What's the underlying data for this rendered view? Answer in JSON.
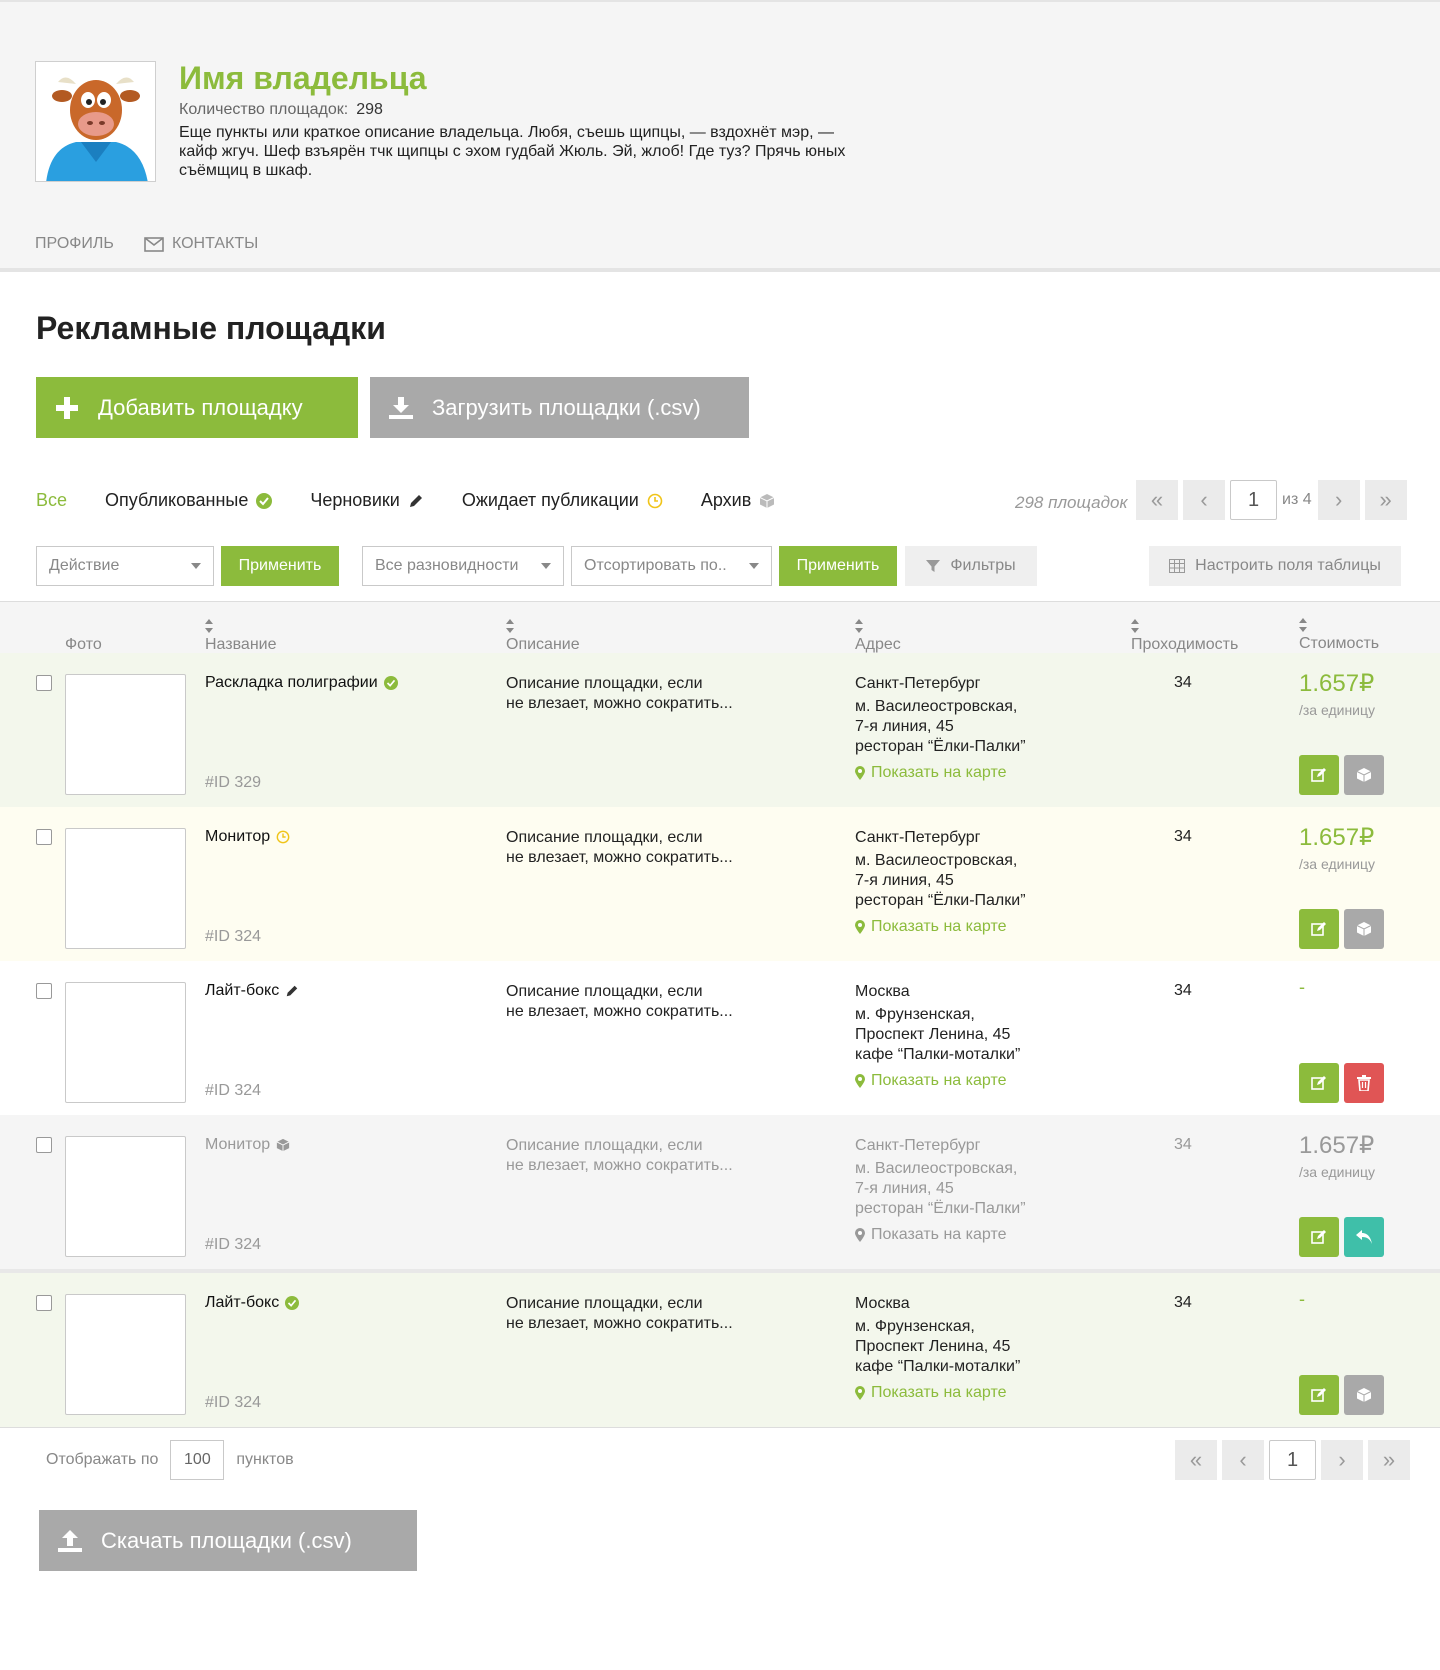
{
  "owner": {
    "name": "Имя владельца",
    "count_label": "Количество площадок:",
    "count_value": "298",
    "description": "Еще пункты или краткое описание владельца. Любя, съешь щипцы, — вздохнёт мэр, — кайф жгуч. Шеф взъярён тчк щипцы с эхом гудбай Жюль. Эй, жлоб! Где туз? Прячь юных съёмщиц в шкаф."
  },
  "tabs": {
    "profile": "ПРОФИЛЬ",
    "contacts": "КОНТАКТЫ"
  },
  "page_title": "Рекламные площадки",
  "buttons": {
    "add": "Добавить площадку",
    "upload": "Загрузить площадки (.csv)",
    "download": "Скачать площадки (.csv)"
  },
  "filters": {
    "all": "Все",
    "published": "Опубликованные",
    "drafts": "Черновики",
    "pending": "Ожидает публикации",
    "archive": "Архив"
  },
  "total": "298 площадок",
  "pager_top": {
    "page": "1",
    "of": "из 4"
  },
  "pager_bottom": {
    "page": "1"
  },
  "controls": {
    "action": "Действие",
    "apply": "Применить",
    "types": "Все разновидности",
    "sort": "Отсортировать по..",
    "filters": "Фильтры",
    "columns": "Настроить поля таблицы"
  },
  "columns": {
    "photo": "Фото",
    "name": "Название",
    "description": "Описание",
    "address": "Адрес",
    "traffic": "Проходимость",
    "cost": "Стоимость"
  },
  "rows": [
    {
      "name": "Раскладка полиграфии",
      "id": "#ID 329",
      "desc1": "Описание площадки, если",
      "desc2": "не влезает, можно сократить...",
      "city": "Санкт-Петербург",
      "a1": "м. Василеостровская,",
      "a2": "7-я линия, 45",
      "a3": "ресторан “Ёлки-Палки”",
      "map": "Показать на карте",
      "traffic": "34",
      "price": "1.657₽",
      "unit": "/за единицу"
    },
    {
      "name": "Монитор",
      "id": "#ID 324",
      "desc1": "Описание площадки, если",
      "desc2": "не влезает, можно сократить...",
      "city": "Санкт-Петербург",
      "a1": "м. Василеостровская,",
      "a2": "7-я линия, 45",
      "a3": "ресторан “Ёлки-Палки”",
      "map": "Показать на карте",
      "traffic": "34",
      "price": "1.657₽",
      "unit": "/за единицу"
    },
    {
      "name": "Лайт-бокс",
      "id": "#ID 324",
      "desc1": "Описание площадки, если",
      "desc2": "не влезает, можно сократить...",
      "city": "Москва",
      "a1": "м. Фрунзенская,",
      "a2": "Проспект Ленина, 45",
      "a3": "кафе “Палки-моталки”",
      "map": "Показать на карте",
      "traffic": "34",
      "price": "-",
      "unit": ""
    },
    {
      "name": "Монитор",
      "id": "#ID 324",
      "desc1": "Описание площадки, если",
      "desc2": "не влезает, можно сократить...",
      "city": "Санкт-Петербург",
      "a1": "м. Василеостровская,",
      "a2": "7-я линия, 45",
      "a3": "ресторан “Ёлки-Палки”",
      "map": "Показать на карте",
      "traffic": "34",
      "price": "1.657₽",
      "unit": "/за единицу"
    },
    {
      "name": "Лайт-бокс",
      "id": "#ID 324",
      "desc1": "Описание площадки, если",
      "desc2": "не влезает, можно сократить...",
      "city": "Москва",
      "a1": "м. Фрунзенская,",
      "a2": "Проспект Ленина, 45",
      "a3": "кафе “Палки-моталки”",
      "map": "Показать на карте",
      "traffic": "34",
      "price": "-",
      "unit": ""
    }
  ],
  "footer": {
    "show_by": "Отображать по",
    "per_page": "100",
    "items": "пунктов"
  },
  "colors": {
    "accent": "#8cbb3c",
    "grey_button": "#a9a9a9",
    "danger": "#e05555",
    "restore": "#3fbfa9"
  }
}
